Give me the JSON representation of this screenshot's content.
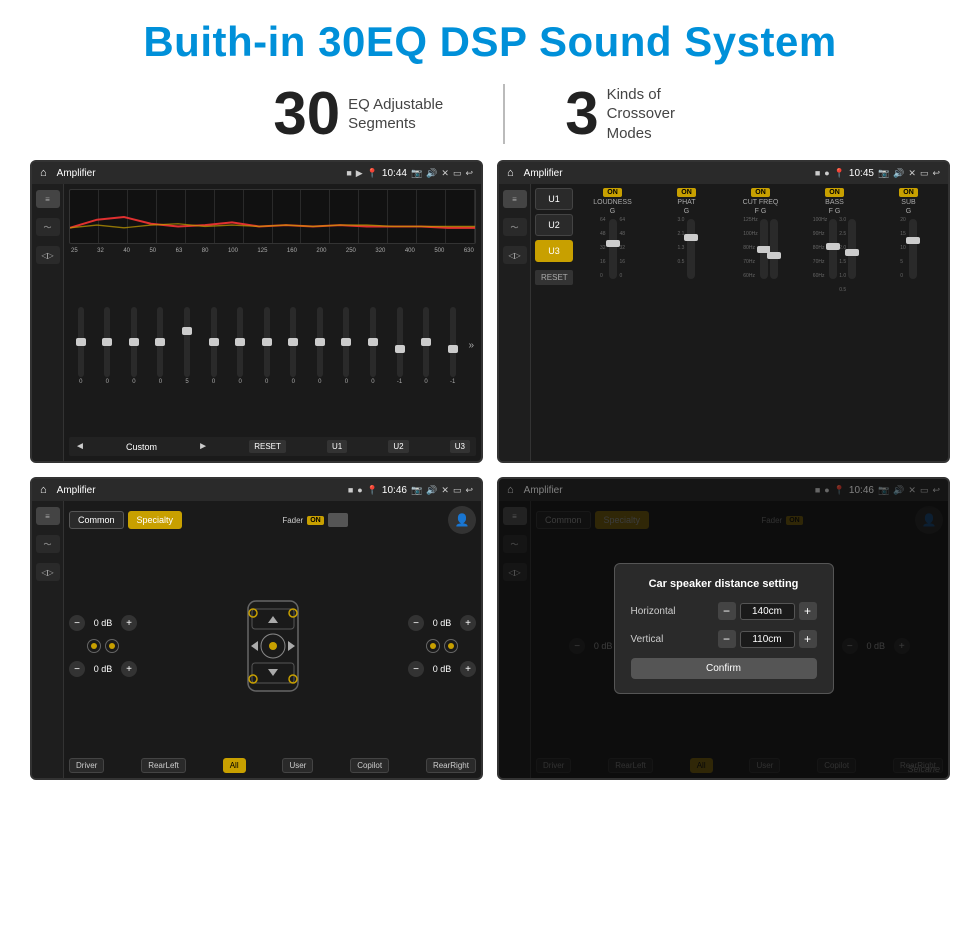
{
  "header": {
    "title": "Buith-in 30EQ DSP Sound System"
  },
  "stats": [
    {
      "number": "30",
      "label": "EQ Adjustable\nSegments"
    },
    {
      "number": "3",
      "label": "Kinds of\nCrossover Modes"
    }
  ],
  "screens": [
    {
      "id": "eq-screen",
      "statusBar": {
        "title": "Amplifier",
        "time": "10:44"
      },
      "type": "eq",
      "freqLabels": [
        "25",
        "32",
        "40",
        "50",
        "63",
        "80",
        "100",
        "125",
        "160",
        "200",
        "250",
        "320",
        "400",
        "500",
        "630"
      ],
      "sliderValues": [
        "0",
        "0",
        "0",
        "0",
        "5",
        "0",
        "0",
        "0",
        "0",
        "0",
        "0",
        "0",
        "-1",
        "0",
        "-1"
      ],
      "presets": [
        "RESET",
        "U1",
        "U2",
        "U3"
      ],
      "navLabel": "Custom"
    },
    {
      "id": "crossover-screen",
      "statusBar": {
        "title": "Amplifier",
        "time": "10:45"
      },
      "type": "crossover",
      "presets": [
        "U1",
        "U2",
        "U3"
      ],
      "activePreset": "U3",
      "channels": [
        {
          "name": "LOUDNESS",
          "on": true,
          "label": "G"
        },
        {
          "name": "PHAT",
          "on": true,
          "label": "G"
        },
        {
          "name": "CUT FREQ",
          "on": true,
          "label": "F G"
        },
        {
          "name": "BASS",
          "on": true,
          "label": "F G"
        },
        {
          "name": "SUB",
          "on": true,
          "label": "G"
        }
      ],
      "resetLabel": "RESET"
    },
    {
      "id": "fader-screen",
      "statusBar": {
        "title": "Amplifier",
        "time": "10:46"
      },
      "type": "fader",
      "presets": [
        "Common",
        "Specialty"
      ],
      "activePreset": "Specialty",
      "faderLabel": "Fader",
      "faderOn": "ON",
      "volumes": [
        {
          "label": "0 dB"
        },
        {
          "label": "0 dB"
        },
        {
          "label": "0 dB"
        },
        {
          "label": "0 dB"
        }
      ],
      "zones": [
        "Driver",
        "RearLeft",
        "All",
        "User",
        "Copilot",
        "RearRight"
      ]
    },
    {
      "id": "dialog-screen",
      "statusBar": {
        "title": "Amplifier",
        "time": "10:46"
      },
      "type": "dialog",
      "dialog": {
        "title": "Car speaker distance setting",
        "rows": [
          {
            "label": "Horizontal",
            "value": "140cm"
          },
          {
            "label": "Vertical",
            "value": "110cm"
          }
        ],
        "confirmLabel": "Confirm"
      }
    }
  ],
  "watermark": "Seicane"
}
